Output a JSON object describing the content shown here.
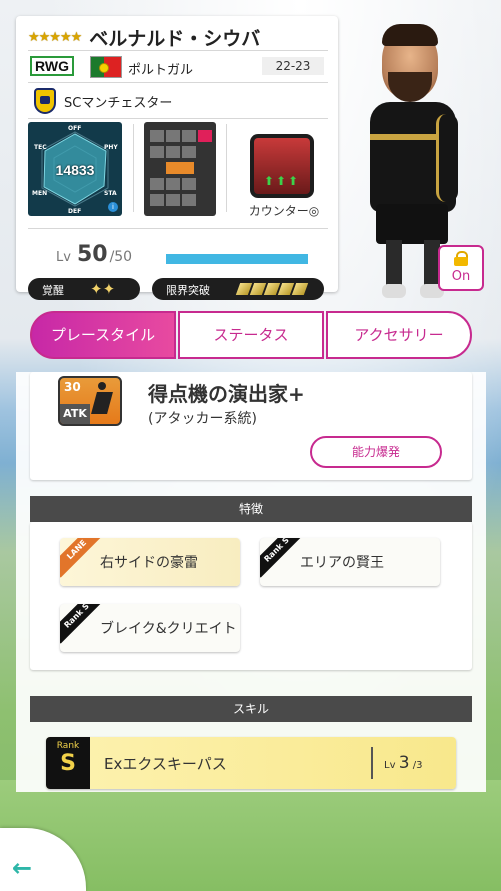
{
  "player": {
    "stars": "★★★★★",
    "name": "ベルナルド・シウバ",
    "position": "RWG",
    "nation": "ポルトガル",
    "season": "22-23",
    "club": "SCマンチェスター",
    "overall": "14833",
    "radar_labels": {
      "off": "OFF",
      "phy": "PHY",
      "sta": "STA",
      "def": "DEF",
      "men": "MEN",
      "tec": "TEC"
    },
    "info_mark": "i",
    "level_prefix": "Lv",
    "level": "50",
    "level_max": "/50",
    "level_progress": 1.0,
    "awakening_label": "覚醒",
    "awakening_icons": "✦✦",
    "limit_break_label": "限界突破",
    "counter_label": "カウンター◎",
    "counter_arrows": "⬆⬆⬆"
  },
  "lock": {
    "label": "On",
    "icon": "lock-icon"
  },
  "tabs": [
    {
      "label": "プレースタイル",
      "active": true
    },
    {
      "label": "ステータス",
      "active": false
    },
    {
      "label": "アクセサリー",
      "active": false
    }
  ],
  "playstyle": {
    "level": "30",
    "tag": "ATK",
    "title": "得点機の演出家+",
    "subtitle": "(アタッカー系統)",
    "burst_button": "能力爆発"
  },
  "traits_header": "特徴",
  "traits": [
    {
      "badge": "LANE",
      "label": "右サイドの豪雷"
    },
    {
      "badge": "Rank S",
      "label": "エリアの賢王"
    },
    {
      "badge": "Rank S",
      "label": "ブレイク&クリエイト"
    }
  ],
  "skills_header": "スキル",
  "skill": {
    "rank_label": "Rank",
    "rank": "S",
    "name": "Exエクスキーパス",
    "lv_prefix": "Lv",
    "lv": "3",
    "lv_max": "/3"
  },
  "back": {
    "icon": "←"
  },
  "colors": {
    "accent": "#c72a8f",
    "level_bar": "#41b7e3",
    "section_header": "#4a4a4a"
  }
}
